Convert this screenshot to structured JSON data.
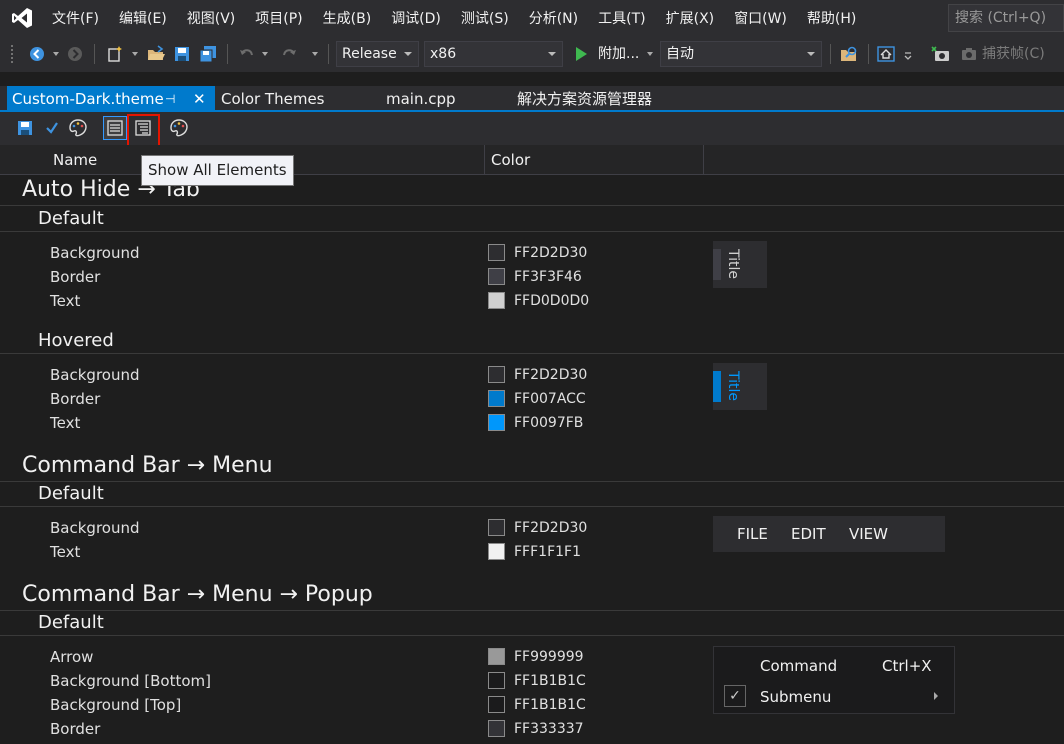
{
  "menubar": {
    "items": [
      "文件(F)",
      "编辑(E)",
      "视图(V)",
      "项目(P)",
      "生成(B)",
      "调试(D)",
      "测试(S)",
      "分析(N)",
      "工具(T)",
      "扩展(X)",
      "窗口(W)",
      "帮助(H)"
    ],
    "search_placeholder": "搜索 (Ctrl+Q)"
  },
  "toolbar": {
    "configuration": "Release",
    "platform": "x86",
    "attach_label": "附加...",
    "attach_target": "自动",
    "capture_frame": "捕获帧(C)"
  },
  "tabs": [
    {
      "label": "Custom-Dark.theme",
      "active": true
    },
    {
      "label": "Color Themes",
      "active": false
    },
    {
      "label": "main.cpp",
      "active": false
    },
    {
      "label": "解决方案资源管理器",
      "active": false
    }
  ],
  "tooltip": "Show All Elements",
  "grid": {
    "name_header": "Name",
    "color_header": "Color"
  },
  "sections": [
    {
      "title": "Auto Hide → Tab",
      "groups": [
        {
          "title": "Default",
          "rows": [
            {
              "name": "Background",
              "color": "FF2D2D30",
              "hex": "#2d2d30"
            },
            {
              "name": "Border",
              "color": "FF3F3F46",
              "hex": "#3f3f46"
            },
            {
              "name": "Text",
              "color": "FFD0D0D0",
              "hex": "#d0d0d0"
            }
          ],
          "preview_label": "Title"
        },
        {
          "title": "Hovered",
          "rows": [
            {
              "name": "Background",
              "color": "FF2D2D30",
              "hex": "#2d2d30"
            },
            {
              "name": "Border",
              "color": "FF007ACC",
              "hex": "#007acc"
            },
            {
              "name": "Text",
              "color": "FF0097FB",
              "hex": "#0097fb"
            }
          ],
          "preview_label": "Title"
        }
      ]
    },
    {
      "title": "Command Bar → Menu",
      "groups": [
        {
          "title": "Default",
          "rows": [
            {
              "name": "Background",
              "color": "FF2D2D30",
              "hex": "#2d2d30"
            },
            {
              "name": "Text",
              "color": "FFF1F1F1",
              "hex": "#f1f1f1"
            }
          ],
          "preview_menu": [
            "FILE",
            "EDIT",
            "VIEW"
          ]
        }
      ]
    },
    {
      "title": "Command Bar → Menu → Popup",
      "groups": [
        {
          "title": "Default",
          "rows": [
            {
              "name": "Arrow",
              "color": "FF999999",
              "hex": "#999999"
            },
            {
              "name": "Background [Bottom]",
              "color": "FF1B1B1C",
              "hex": "#1b1b1c"
            },
            {
              "name": "Background [Top]",
              "color": "FF1B1B1C",
              "hex": "#1b1b1c"
            },
            {
              "name": "Border",
              "color": "FF333337",
              "hex": "#333337"
            }
          ],
          "preview_popup": {
            "command": "Command",
            "shortcut": "Ctrl+X",
            "submenu": "Submenu"
          }
        }
      ]
    }
  ],
  "colors": {
    "accent": "#007acc",
    "chrome": "#2d2d30",
    "editor_bg": "#1e1e1e",
    "highlight": "#e51400"
  }
}
